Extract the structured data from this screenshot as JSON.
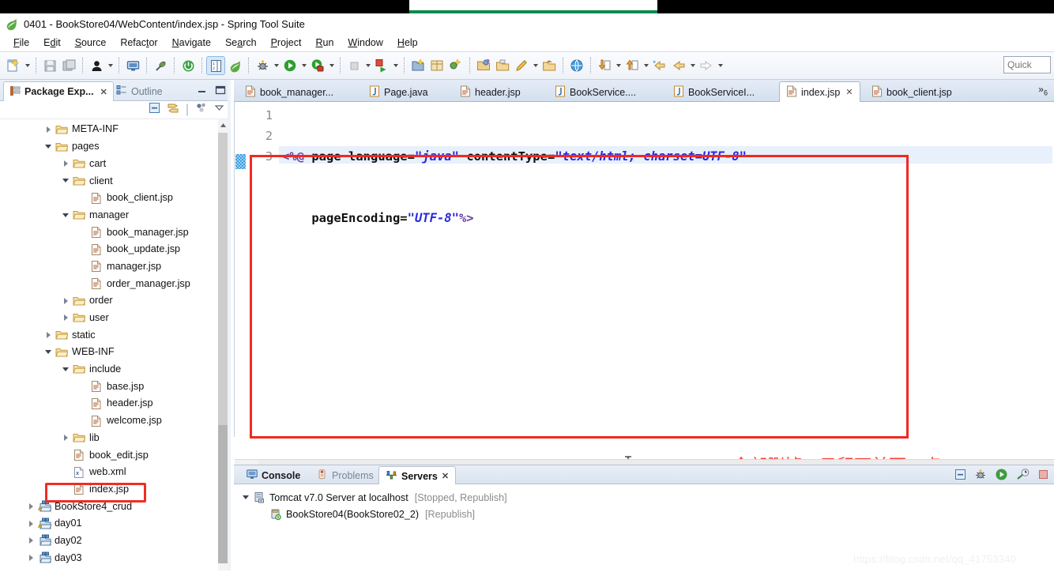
{
  "window": {
    "title": "0401 - BookStore04/WebContent/index.jsp - Spring Tool Suite",
    "logo_icon": "spring-leaf-icon"
  },
  "menu": {
    "items": [
      {
        "label": "File",
        "accel": "F"
      },
      {
        "label": "Edit",
        "accel": "E"
      },
      {
        "label": "Source",
        "accel": "S"
      },
      {
        "label": "Refactor",
        "accel": "t"
      },
      {
        "label": "Navigate",
        "accel": "N"
      },
      {
        "label": "Search",
        "accel": "a"
      },
      {
        "label": "Project",
        "accel": "P"
      },
      {
        "label": "Run",
        "accel": "R"
      },
      {
        "label": "Window",
        "accel": "W"
      },
      {
        "label": "Help",
        "accel": "H"
      }
    ]
  },
  "toolbar": {
    "quick_access_placeholder": "Quick",
    "buttons": [
      {
        "name": "new-wizard-icon"
      },
      {
        "name": "new-wizard-dropdown-icon"
      },
      {
        "name": "save-icon"
      },
      {
        "name": "save-all-icon"
      },
      {
        "name": "person-icon"
      },
      {
        "name": "person-dropdown-icon"
      },
      {
        "name": "console-icon"
      },
      {
        "name": "pin-icon"
      },
      {
        "name": "spring-boot-icon"
      },
      {
        "name": "open-type-icon"
      },
      {
        "name": "spring-leaf-icon"
      },
      {
        "name": "debug-icon"
      },
      {
        "name": "debug-dropdown-icon"
      },
      {
        "name": "run-icon"
      },
      {
        "name": "run-dropdown-icon"
      },
      {
        "name": "run-server-icon"
      },
      {
        "name": "run-server-dropdown-icon"
      },
      {
        "name": "stop-icon"
      },
      {
        "name": "stop-dropdown-icon"
      },
      {
        "name": "publish-icon"
      },
      {
        "name": "publish-dropdown-icon"
      },
      {
        "name": "new-java-project-icon"
      },
      {
        "name": "new-package-icon"
      },
      {
        "name": "new-class-icon"
      },
      {
        "name": "new-class-dropdown-icon"
      },
      {
        "name": "open-folder-icon"
      },
      {
        "name": "export-icon"
      },
      {
        "name": "edit-icon"
      },
      {
        "name": "edit-dropdown-icon"
      },
      {
        "name": "import-icon"
      },
      {
        "name": "web-browser-icon"
      },
      {
        "name": "download-icon"
      },
      {
        "name": "download-dropdown-icon"
      },
      {
        "name": "upload-icon"
      },
      {
        "name": "upload-dropdown-icon"
      },
      {
        "name": "back-history-icon"
      },
      {
        "name": "back-icon"
      },
      {
        "name": "back-dropdown-icon"
      },
      {
        "name": "forward-icon"
      },
      {
        "name": "forward-dropdown-icon"
      }
    ]
  },
  "left_view": {
    "tabs": [
      {
        "label": "Package Exp...",
        "icon": "package-explorer-icon",
        "active": true,
        "closable": true
      },
      {
        "label": "Outline",
        "icon": "outline-icon",
        "active": false,
        "closable": false
      }
    ],
    "view_buttons": [
      "minimize-icon",
      "maximize-icon"
    ],
    "toolbar_icons": [
      "collapse-all-icon",
      "link-with-editor-icon",
      "view-menu-icon",
      "view-dropdown-icon"
    ],
    "tree": [
      {
        "label": "META-INF",
        "kind": "folder",
        "depth": 2,
        "state": "collapsed"
      },
      {
        "label": "pages",
        "kind": "folder",
        "depth": 2,
        "state": "expanded"
      },
      {
        "label": "cart",
        "kind": "folder",
        "depth": 3,
        "state": "collapsed"
      },
      {
        "label": "client",
        "kind": "folder",
        "depth": 3,
        "state": "expanded"
      },
      {
        "label": "book_client.jsp",
        "kind": "jsp",
        "depth": 4,
        "state": "leaf"
      },
      {
        "label": "manager",
        "kind": "folder",
        "depth": 3,
        "state": "expanded"
      },
      {
        "label": "book_manager.jsp",
        "kind": "jsp",
        "depth": 4,
        "state": "leaf"
      },
      {
        "label": "book_update.jsp",
        "kind": "jsp",
        "depth": 4,
        "state": "leaf"
      },
      {
        "label": "manager.jsp",
        "kind": "jsp",
        "depth": 4,
        "state": "leaf"
      },
      {
        "label": "order_manager.jsp",
        "kind": "jsp",
        "depth": 4,
        "state": "leaf"
      },
      {
        "label": "order",
        "kind": "folder",
        "depth": 3,
        "state": "collapsed"
      },
      {
        "label": "user",
        "kind": "folder",
        "depth": 3,
        "state": "collapsed"
      },
      {
        "label": "static",
        "kind": "folder",
        "depth": 2,
        "state": "collapsed"
      },
      {
        "label": "WEB-INF",
        "kind": "folder",
        "depth": 2,
        "state": "expanded"
      },
      {
        "label": "include",
        "kind": "folder",
        "depth": 3,
        "state": "expanded"
      },
      {
        "label": "base.jsp",
        "kind": "jsp",
        "depth": 4,
        "state": "leaf"
      },
      {
        "label": "header.jsp",
        "kind": "jsp",
        "depth": 4,
        "state": "leaf"
      },
      {
        "label": "welcome.jsp",
        "kind": "jsp",
        "depth": 4,
        "state": "leaf"
      },
      {
        "label": "lib",
        "kind": "folder",
        "depth": 3,
        "state": "collapsed"
      },
      {
        "label": "book_edit.jsp",
        "kind": "jsp",
        "depth": 3,
        "state": "leaf"
      },
      {
        "label": "web.xml",
        "kind": "xml",
        "depth": 3,
        "state": "leaf"
      },
      {
        "label": "index.jsp",
        "kind": "jsp",
        "depth": 3,
        "state": "leaf",
        "highlighted": true
      },
      {
        "label": "BookStore4_crud",
        "kind": "project-warn",
        "depth": 1,
        "state": "collapsed"
      },
      {
        "label": "day01",
        "kind": "project-warn",
        "depth": 1,
        "state": "collapsed"
      },
      {
        "label": "day02",
        "kind": "project",
        "depth": 1,
        "state": "collapsed"
      },
      {
        "label": "day03",
        "kind": "project",
        "depth": 1,
        "state": "collapsed"
      }
    ]
  },
  "editor": {
    "tabs": [
      {
        "label": "book_manager...",
        "icon": "jsp-file-icon",
        "active": false,
        "closable": false
      },
      {
        "label": "Page.java",
        "icon": "java-file-icon",
        "active": false,
        "closable": false
      },
      {
        "label": "header.jsp",
        "icon": "jsp-file-icon",
        "active": false,
        "closable": false
      },
      {
        "label": "BookService....",
        "icon": "java-file-icon",
        "active": false,
        "closable": false
      },
      {
        "label": "BookServiceI...",
        "icon": "java-file-icon",
        "active": false,
        "closable": false
      },
      {
        "label": "index.jsp",
        "icon": "jsp-file-icon",
        "active": true,
        "closable": true
      },
      {
        "label": "book_client.jsp",
        "icon": "jsp-file-icon",
        "active": false,
        "closable": false
      }
    ],
    "more_tabs_count": "6",
    "more_tabs_symbol": "»",
    "line_numbers": [
      "1",
      "2",
      "3"
    ],
    "code_lines": [
      [
        {
          "t": "<%@ ",
          "c": "tag"
        },
        {
          "t": "page ",
          "c": "plain"
        },
        {
          "t": "language=",
          "c": "plain"
        },
        {
          "t": "\"java\"",
          "c": "str"
        },
        {
          "t": " contentType=",
          "c": "plain"
        },
        {
          "t": "\"text/html; charset=UTF-8\"",
          "c": "str"
        }
      ],
      [
        {
          "t": "    pageEncoding=",
          "c": "plain"
        },
        {
          "t": "\"UTF-8\"",
          "c": "str"
        },
        {
          "t": "%>",
          "c": "tag"
        }
      ],
      []
    ],
    "annotation": "全部删掉，只留下前面一点",
    "mouse_cursor": "i-beam-cursor",
    "scroll_left_icon": "chevron-left-icon"
  },
  "bottom_panel": {
    "tabs": [
      {
        "label": "Console",
        "icon": "console-icon",
        "active": false,
        "closable": false
      },
      {
        "label": "Problems",
        "icon": "problems-icon",
        "active": false,
        "closable": false
      },
      {
        "label": "Servers",
        "icon": "servers-icon",
        "active": true,
        "closable": true
      }
    ],
    "toolbar_icons": [
      "collapse-all-icon",
      "debug-server-icon",
      "start-server-icon",
      "profile-server-icon",
      "stop-server-icon"
    ],
    "rows": [
      {
        "label": "Tomcat v7.0 Server at localhost",
        "status": "[Stopped, Republish]",
        "icon": "server-icon",
        "depth": 0,
        "state": "expanded"
      },
      {
        "label": "BookStore04(BookStore02_2)",
        "status": "[Republish]",
        "icon": "module-icon",
        "depth": 1,
        "state": "leaf"
      }
    ]
  },
  "watermark": "https://blog.csdn.net/qq_41753340",
  "colors": {
    "accent_red": "#f02a20",
    "annotation_red": "#f7423a",
    "string_blue": "#2a2ae0",
    "tag_purple": "#6a3fa0",
    "selection_blue": "#e8f0fb"
  }
}
